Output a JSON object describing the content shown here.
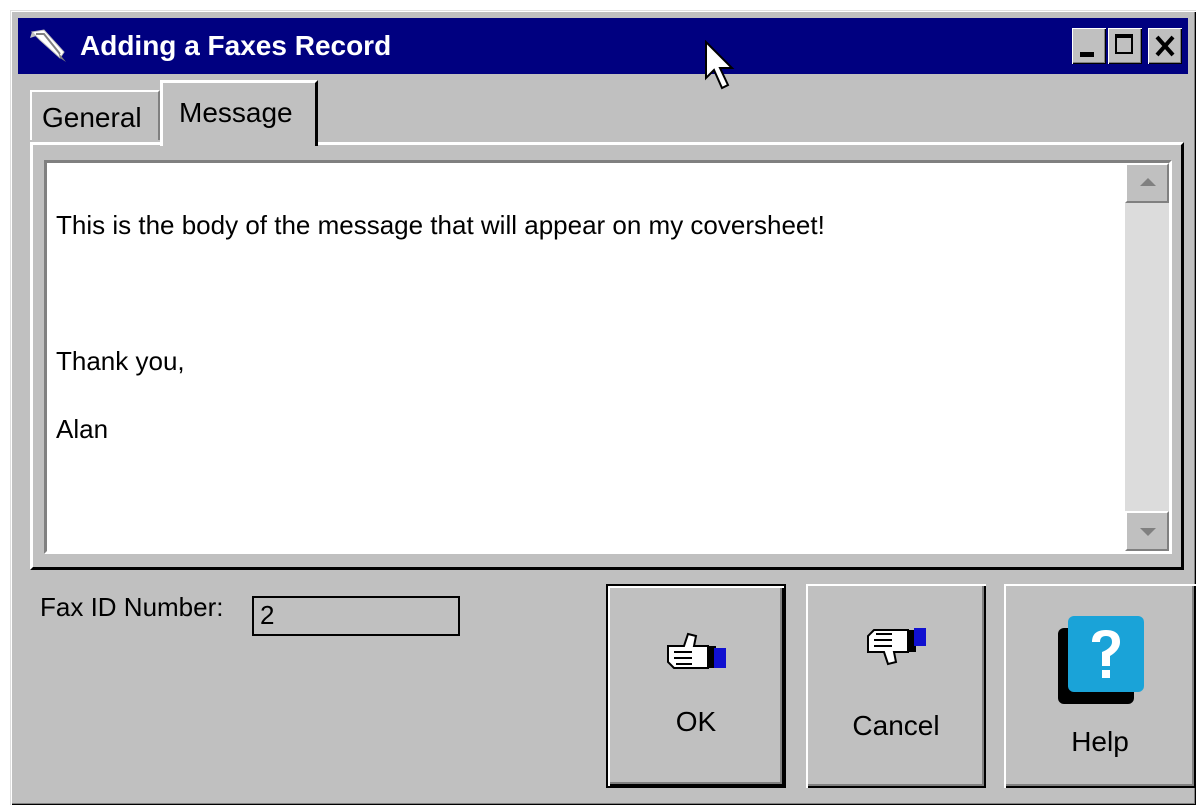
{
  "window": {
    "title": "Adding a Faxes Record"
  },
  "tabs": [
    {
      "label": "General",
      "active": false
    },
    {
      "label": "Message",
      "active": true
    }
  ],
  "message": {
    "lines": [
      "This is the body of the message that will appear on my coversheet!",
      "",
      "Thank you,",
      "Alan"
    ]
  },
  "fax_id": {
    "label": "Fax ID Number:",
    "value": "2"
  },
  "buttons": {
    "ok": "OK",
    "cancel": "Cancel",
    "help": "Help"
  },
  "colors": {
    "title_bar": "#000080",
    "window_face": "#c0c0c0",
    "help_icon": "#1aa3d8"
  },
  "icons": {
    "title": "quill-pen-icon",
    "ok": "thumbs-up-icon",
    "cancel": "thumbs-down-icon",
    "help": "question-mark-icon"
  }
}
